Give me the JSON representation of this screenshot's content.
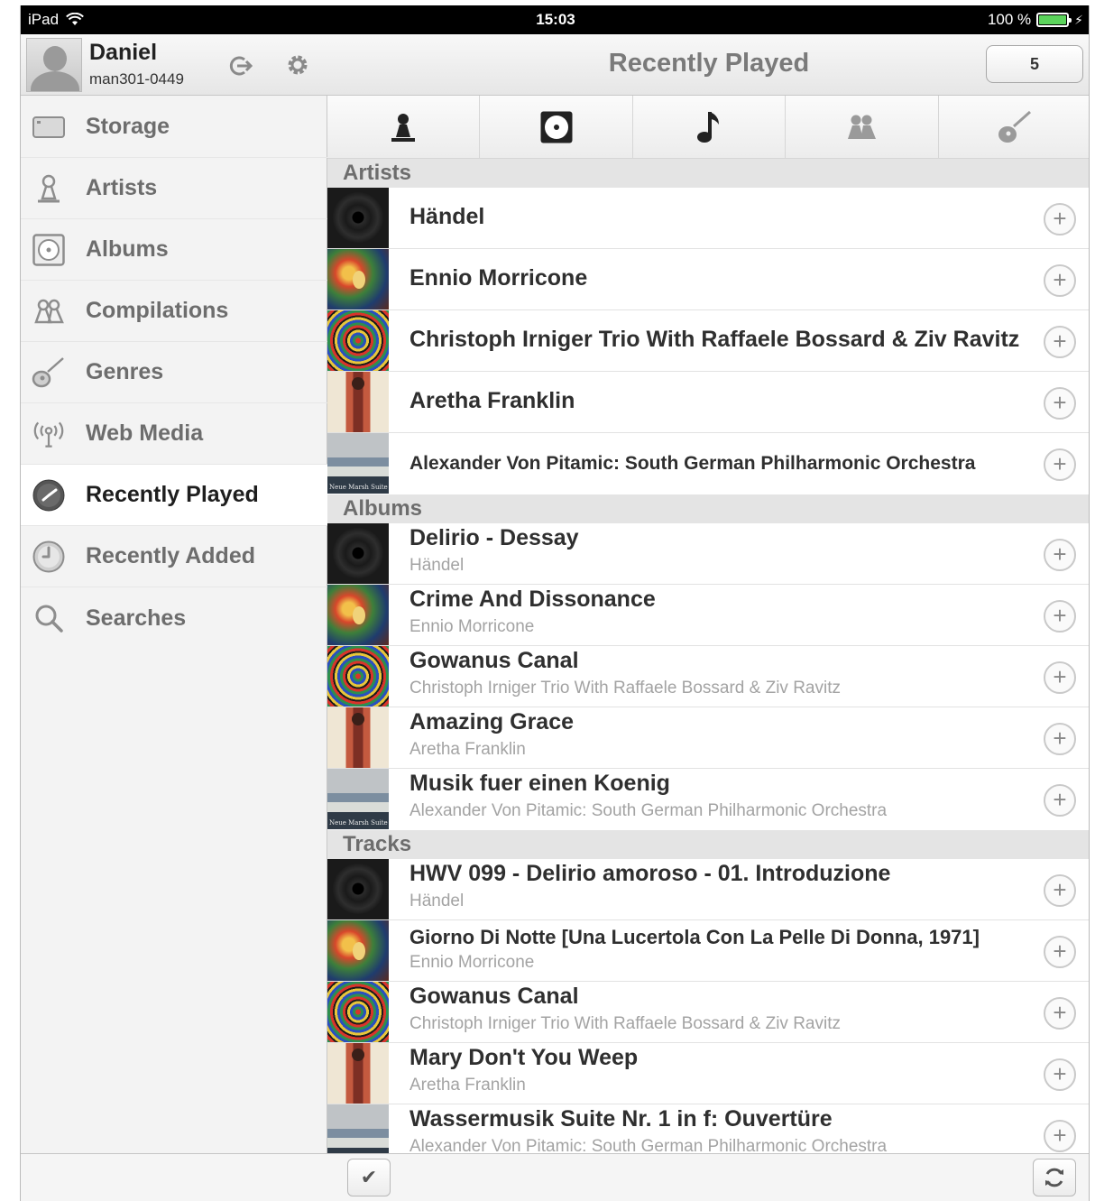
{
  "status_bar": {
    "device": "iPad",
    "time": "15:03",
    "battery": "100 %",
    "battery_level": 1.0
  },
  "user": {
    "name": "Daniel",
    "id": "man301-0449"
  },
  "sidebar": {
    "items": [
      {
        "label": "Storage",
        "icon": "storage-icon"
      },
      {
        "label": "Artists",
        "icon": "artist-icon"
      },
      {
        "label": "Albums",
        "icon": "album-icon"
      },
      {
        "label": "Compilations",
        "icon": "compilations-icon"
      },
      {
        "label": "Genres",
        "icon": "guitar-icon"
      },
      {
        "label": "Web Media",
        "icon": "broadcast-icon"
      },
      {
        "label": "Recently Played",
        "icon": "clock-icon",
        "active": true
      },
      {
        "label": "Recently Added",
        "icon": "clock-icon"
      },
      {
        "label": "Searches",
        "icon": "search-icon"
      }
    ]
  },
  "main": {
    "title": "Recently Played",
    "count": "5",
    "tabs": [
      "artist-icon",
      "album-icon",
      "music-note-icon",
      "compilations-icon",
      "guitar-icon"
    ],
    "active_tab": 0,
    "sections": {
      "artists": {
        "header": "Artists",
        "rows": [
          {
            "title": "Händel",
            "art": "vinyl"
          },
          {
            "title": "Ennio Morricone",
            "art": "face"
          },
          {
            "title": "Christoph Irniger Trio With Raffaele Bossard & Ziv Ravitz",
            "art": "swirl"
          },
          {
            "title": "Aretha Franklin",
            "art": "aretha"
          },
          {
            "title": "Alexander Von Pitamic: South German Philharmonic Orchestra",
            "art": "orch"
          }
        ]
      },
      "albums": {
        "header": "Albums",
        "rows": [
          {
            "title": "Delirio - Dessay",
            "subtitle": "Händel",
            "art": "vinyl"
          },
          {
            "title": "Crime And Dissonance",
            "subtitle": "Ennio Morricone",
            "art": "face"
          },
          {
            "title": "Gowanus Canal",
            "subtitle": "Christoph Irniger Trio With Raffaele Bossard & Ziv Ravitz",
            "art": "swirl"
          },
          {
            "title": "Amazing Grace",
            "subtitle": "Aretha Franklin",
            "art": "aretha"
          },
          {
            "title": "Musik fuer einen Koenig",
            "subtitle": "Alexander Von Pitamic: South German Philharmonic Orchestra",
            "art": "orch"
          }
        ]
      },
      "tracks": {
        "header": "Tracks",
        "rows": [
          {
            "title": "HWV 099 - Delirio amoroso - 01. Introduzione",
            "subtitle": "Händel",
            "art": "vinyl"
          },
          {
            "title": "Giorno Di Notte [Una Lucertola Con La Pelle Di Donna, 1971]",
            "subtitle": "Ennio Morricone",
            "art": "face"
          },
          {
            "title": "Gowanus Canal",
            "subtitle": "Christoph Irniger Trio With Raffaele Bossard & Ziv Ravitz",
            "art": "swirl"
          },
          {
            "title": "Mary Don't You Weep",
            "subtitle": "Aretha Franklin",
            "art": "aretha"
          },
          {
            "title": "Wassermusik Suite Nr. 1 in f: Ouvertüre",
            "subtitle": "Alexander Von Pitamic: South German Philharmonic Orchestra",
            "art": "orch"
          }
        ]
      }
    },
    "add_symbol": "+",
    "bottom": {
      "check_icon": "checkmark-icon",
      "refresh_icon": "refresh-icon"
    }
  }
}
